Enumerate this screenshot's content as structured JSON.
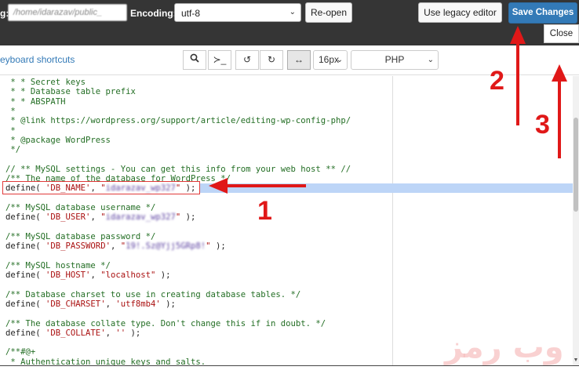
{
  "header": {
    "path_label_fragment": "g:",
    "path_value": "/home/idarazav/public_",
    "encoding_label": "Encoding:",
    "encoding_value": "utf-8",
    "reopen_label": "Re-open",
    "legacy_label": "Use legacy editor",
    "save_label": "Save Changes",
    "close_label": "Close"
  },
  "toolbar": {
    "shortcuts_label": "eyboard shortcuts",
    "search_glyph": "🔍",
    "terminal_glyph": "≻_",
    "undo_glyph": "↺",
    "redo_glyph": "↻",
    "wrap_glyph": "↔",
    "font_size": "16px",
    "mode": "PHP"
  },
  "code_lines": [
    " * * Secret keys",
    " * * Database table prefix",
    " * * ABSPATH",
    " *",
    " * @link https://wordpress.org/support/article/editing-wp-config-php/",
    " *",
    " * @package WordPress",
    " */",
    "",
    "// ** MySQL settings - You can get this info from your web host ** //",
    "/** The name of the database for WordPress */",
    "define( 'DB_NAME', \"idarazav_wp327\" );",
    "",
    "/** MySQL database username */",
    "define( 'DB_USER', \"idarazav_wp327\" );",
    "",
    "/** MySQL database password */",
    "define( 'DB_PASSWORD', \"19!.Sz@Yjj5GRp8!\" );",
    "",
    "/** MySQL hostname */",
    "define( 'DB_HOST', \"localhost\" );",
    "",
    "/** Database charset to use in creating database tables. */",
    "define( 'DB_CHARSET', 'utf8mb4' );",
    "",
    "/** The database collate type. Don't change this if in doubt. */",
    "define( 'DB_COLLATE', '' );",
    "",
    "/**#@+",
    " * Authentication unique keys and salts."
  ],
  "annotations": {
    "step1": "1",
    "step2": "2",
    "step3": "3",
    "watermark": "وب رمز",
    "color": "#e01818"
  }
}
